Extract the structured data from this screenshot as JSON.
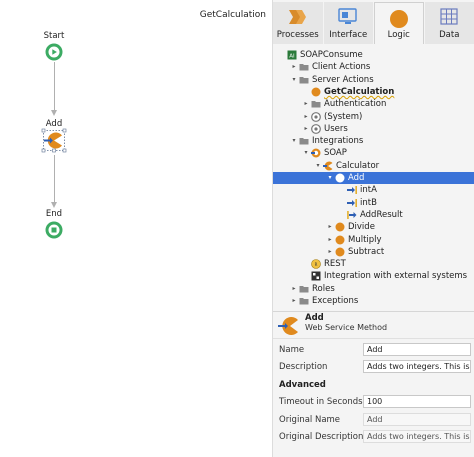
{
  "canvas": {
    "title": "GetCalculation",
    "nodes": [
      {
        "label": "Start",
        "icon": "start-icon"
      },
      {
        "label": "Add",
        "icon": "web-service-call-icon"
      },
      {
        "label": "End",
        "icon": "end-icon"
      }
    ]
  },
  "tabs": [
    {
      "label": "Processes",
      "icon": "processes-icon"
    },
    {
      "label": "Interface",
      "icon": "interface-icon"
    },
    {
      "label": "Logic",
      "icon": "logic-icon",
      "active": true
    },
    {
      "label": "Data",
      "icon": "data-icon"
    }
  ],
  "tree": [
    {
      "label": "SOAPConsume",
      "indent": 0,
      "arrow": "",
      "icon": "module-icon"
    },
    {
      "label": "Client Actions",
      "indent": 1,
      "arrow": "▸",
      "icon": "folder-icon"
    },
    {
      "label": "Server Actions",
      "indent": 1,
      "arrow": "▾",
      "icon": "folder-icon"
    },
    {
      "label": "GetCalculation",
      "indent": 2,
      "arrow": "",
      "icon": "action-icon",
      "bold": true
    },
    {
      "label": "Authentication",
      "indent": 2,
      "arrow": "▸",
      "icon": "folder-icon"
    },
    {
      "label": "(System)",
      "indent": 2,
      "arrow": "▸",
      "icon": "system-icon"
    },
    {
      "label": "Users",
      "indent": 2,
      "arrow": "▸",
      "icon": "system-icon"
    },
    {
      "label": "Integrations",
      "indent": 1,
      "arrow": "▾",
      "icon": "folder-icon"
    },
    {
      "label": "SOAP",
      "indent": 2,
      "arrow": "▾",
      "icon": "soap-icon"
    },
    {
      "label": "Calculator",
      "indent": 3,
      "arrow": "▾",
      "icon": "service-icon"
    },
    {
      "label": "Add",
      "indent": 4,
      "arrow": "▾",
      "icon": "method-icon",
      "selected": true
    },
    {
      "label": "intA",
      "indent": 5,
      "arrow": "",
      "icon": "input-param-icon"
    },
    {
      "label": "intB",
      "indent": 5,
      "arrow": "",
      "icon": "input-param-icon"
    },
    {
      "label": "AddResult",
      "indent": 5,
      "arrow": "",
      "icon": "output-param-icon"
    },
    {
      "label": "Divide",
      "indent": 4,
      "arrow": "▸",
      "icon": "method-icon"
    },
    {
      "label": "Multiply",
      "indent": 4,
      "arrow": "▸",
      "icon": "method-icon"
    },
    {
      "label": "Subtract",
      "indent": 4,
      "arrow": "▸",
      "icon": "method-icon"
    },
    {
      "label": "REST",
      "indent": 2,
      "arrow": "",
      "icon": "rest-icon"
    },
    {
      "label": "Integration with external systems",
      "indent": 2,
      "arrow": "",
      "icon": "external-icon"
    },
    {
      "label": "Roles",
      "indent": 1,
      "arrow": "▸",
      "icon": "folder-icon"
    },
    {
      "label": "Exceptions",
      "indent": 1,
      "arrow": "▸",
      "icon": "folder-icon"
    }
  ],
  "properties": {
    "title": "Add",
    "subtitle": "Web Service Method",
    "name_label": "Name",
    "name_value": "Add",
    "description_label": "Description",
    "description_value": "Adds two integers. This is a",
    "advanced_label": "Advanced",
    "timeout_label": "Timeout in Seconds",
    "timeout_value": "100",
    "original_name_label": "Original Name",
    "original_name_value": "Add",
    "original_description_label": "Original Description",
    "original_description_value": "Adds two integers. This is a t"
  },
  "colors": {
    "selection": "#3b73d8",
    "start_node": "#3cab63",
    "method_orange": "#e08a1e",
    "tab_accent": "#f39c12"
  }
}
